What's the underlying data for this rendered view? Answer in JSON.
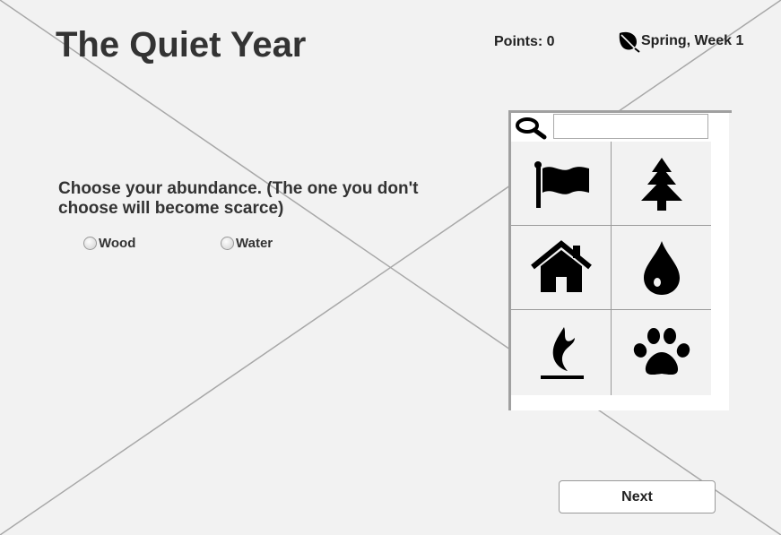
{
  "app": {
    "title": "The Quiet Year"
  },
  "status": {
    "points": "Points: 0",
    "season": "Spring, Week 1",
    "season_icon": "leaf-icon"
  },
  "prompt": {
    "question": "Choose your abundance. (The one you don't choose will become scarce)",
    "options": [
      {
        "label": "Wood"
      },
      {
        "label": "Water"
      }
    ]
  },
  "icon_panel": {
    "search_value": "",
    "icons": [
      "flag-icon",
      "tree-icon",
      "house-icon",
      "water-drop-icon",
      "fire-icon",
      "paw-icon"
    ]
  },
  "next_button": {
    "label": "Next"
  },
  "colors": {
    "background": "#f2f2f2",
    "text": "#333333",
    "icon": "#000000",
    "panel_border": "#a0a0a0"
  }
}
